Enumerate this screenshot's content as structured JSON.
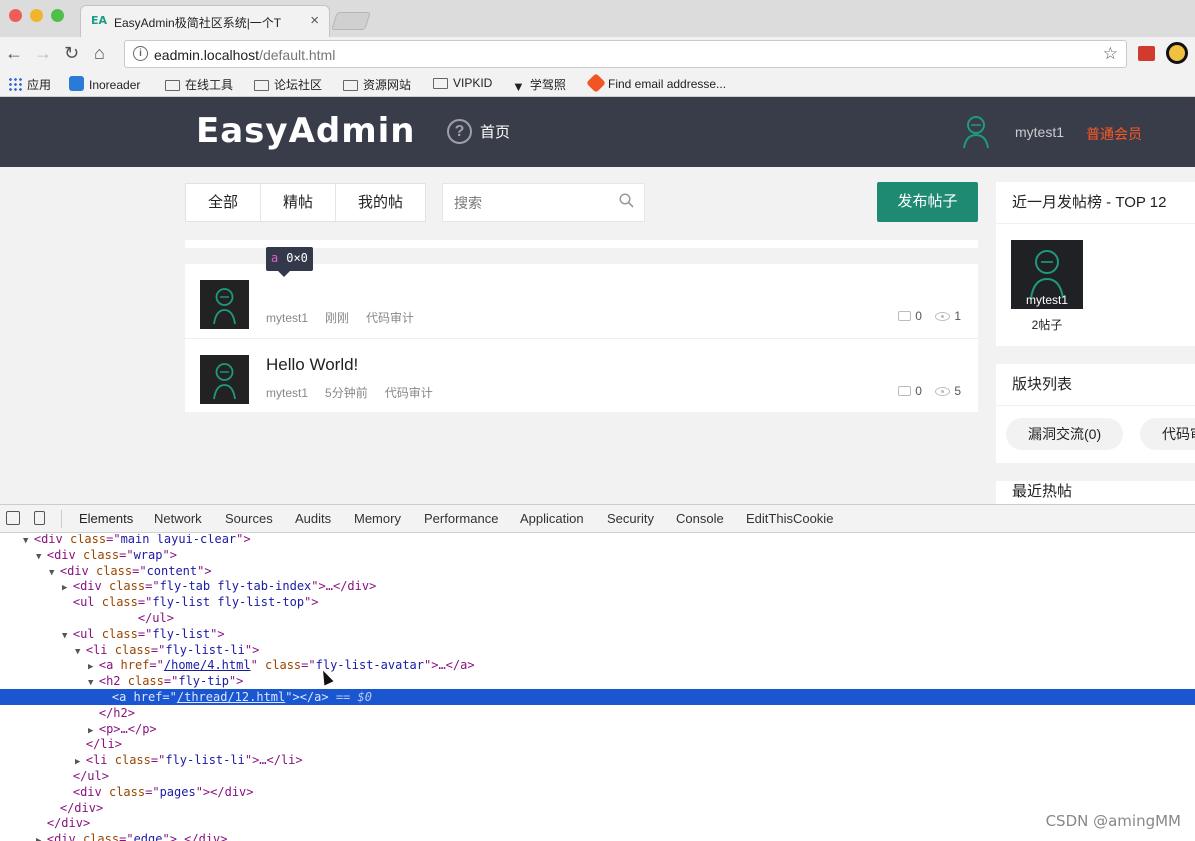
{
  "browser": {
    "tab_title": "EasyAdmin极简社区系统|一个T",
    "tab_favicon": "EA",
    "url_host": "eadmin.localhost",
    "url_path": "/default.html",
    "bookmarks": [
      "应用",
      "Inoreader",
      "在线工具",
      "论坛社区",
      "资源网站",
      "VIPKID",
      "学驾照",
      "Find email addresse..."
    ]
  },
  "header": {
    "logo": "EasyAdmin",
    "nav_home": "首页",
    "username": "mytest1",
    "role": "普通会员"
  },
  "tabs": [
    "全部",
    "精帖",
    "我的帖"
  ],
  "search": {
    "placeholder": "搜索"
  },
  "post_button": "发布帖子",
  "inspect_tooltip": {
    "tag": "a",
    "size": "0×0"
  },
  "posts": [
    {
      "title": "",
      "author": "mytest1",
      "time": "刚刚",
      "category": "代码审计",
      "comments": "0",
      "views": "1"
    },
    {
      "title": "Hello World!",
      "author": "mytest1",
      "time": "5分钟前",
      "category": "代码审计",
      "comments": "0",
      "views": "5"
    }
  ],
  "sidebar": {
    "top_title": "近一月发帖榜 - TOP 12",
    "top_user": {
      "name": "mytest1",
      "posts": "2帖子"
    },
    "forums_title": "版块列表",
    "forums": [
      "漏洞交流(0)",
      "代码审"
    ],
    "hot_title": "最近热帖"
  },
  "devtools": {
    "tabs": [
      "Elements",
      "Network",
      "Sources",
      "Audits",
      "Memory",
      "Performance",
      "Application",
      "Security",
      "Console",
      "EditThisCookie"
    ],
    "lines": [
      {
        "indent": 1,
        "arrow": "▼",
        "open": "<div",
        "attrs": [
          [
            "class",
            "main layui-clear"
          ]
        ],
        "close": ">"
      },
      {
        "indent": 2,
        "arrow": "▼",
        "open": "<div",
        "attrs": [
          [
            "class",
            "wrap"
          ]
        ],
        "close": ">"
      },
      {
        "indent": 3,
        "arrow": "▼",
        "open": "<div",
        "attrs": [
          [
            "class",
            "content"
          ]
        ],
        "close": ">"
      },
      {
        "indent": 4,
        "arrow": "▶",
        "open": "<div",
        "attrs": [
          [
            "class",
            "fly-tab fly-tab-index"
          ]
        ],
        "close": ">…</div>"
      },
      {
        "indent": 4,
        "arrow": " ",
        "open": "<ul",
        "attrs": [
          [
            "class",
            "fly-list fly-list-top"
          ]
        ],
        "close": ">"
      },
      {
        "indent": 9,
        "arrow": " ",
        "open": "</ul>",
        "attrs": [],
        "close": ""
      },
      {
        "indent": 4,
        "arrow": "▼",
        "open": "<ul",
        "attrs": [
          [
            "class",
            "fly-list"
          ]
        ],
        "close": ">"
      },
      {
        "indent": 5,
        "arrow": "▼",
        "open": "<li",
        "attrs": [
          [
            "class",
            "fly-list-li"
          ]
        ],
        "close": ">"
      },
      {
        "indent": 6,
        "arrow": "▶",
        "open": "<a",
        "attrs": [
          [
            "href",
            "/home/4.html"
          ],
          [
            "class",
            "fly-list-avatar"
          ]
        ],
        "close": ">…</a>"
      },
      {
        "indent": 6,
        "arrow": "▼",
        "open": "<h2",
        "attrs": [
          [
            "class",
            "fly-tip"
          ]
        ],
        "close": ">"
      },
      {
        "indent": 7,
        "arrow": " ",
        "open": "<a",
        "attrs": [
          [
            "href",
            "/thread/12.html"
          ]
        ],
        "close": "></a>",
        "selected": true,
        "suffix": " == $0"
      },
      {
        "indent": 6,
        "arrow": " ",
        "open": "</h2>",
        "attrs": [],
        "close": ""
      },
      {
        "indent": 6,
        "arrow": "▶",
        "open": "<p>",
        "attrs": [],
        "close": "…</p>"
      },
      {
        "indent": 5,
        "arrow": " ",
        "open": "</li>",
        "attrs": [],
        "close": ""
      },
      {
        "indent": 5,
        "arrow": "▶",
        "open": "<li",
        "attrs": [
          [
            "class",
            "fly-list-li"
          ]
        ],
        "close": ">…</li>"
      },
      {
        "indent": 4,
        "arrow": " ",
        "open": "</ul>",
        "attrs": [],
        "close": ""
      },
      {
        "indent": 4,
        "arrow": " ",
        "open": "<div",
        "attrs": [
          [
            "class",
            "pages"
          ]
        ],
        "close": "></div>"
      },
      {
        "indent": 3,
        "arrow": " ",
        "open": "</div>",
        "attrs": [],
        "close": ""
      },
      {
        "indent": 2,
        "arrow": " ",
        "open": "</div>",
        "attrs": [],
        "close": ""
      },
      {
        "indent": 2,
        "arrow": "▶",
        "open": "<div",
        "attrs": [
          [
            "class",
            "edge"
          ]
        ],
        "close": ">…</div>"
      }
    ]
  },
  "watermark": "CSDN @amingMM",
  "colors": {
    "accent": "#1e8a72",
    "header_bg": "#393d49",
    "role": "#ff5722",
    "selected": "#1a56cf"
  }
}
